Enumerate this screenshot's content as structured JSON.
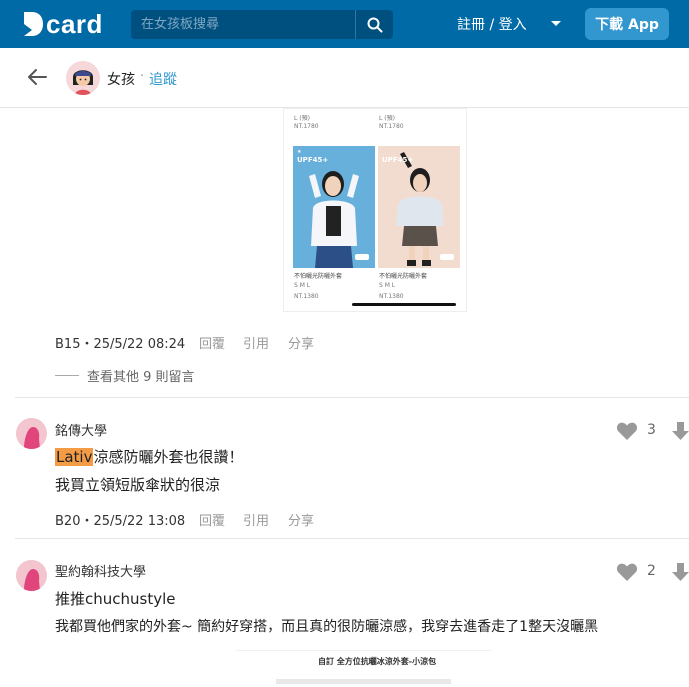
{
  "header": {
    "logo_text": "card",
    "search_placeholder": "在女孩板搜尋",
    "login_label": "註冊 / 登入",
    "download_label": "下載 App",
    "brand_color": "#006aa6"
  },
  "forum": {
    "name": "女孩",
    "separator": "·",
    "follow_label": "追蹤"
  },
  "reply_image": {
    "size_top_left": "L (預)",
    "size_top_right": "L (預)",
    "price_top_left": "NT.1780",
    "price_top_right": "NT.1780",
    "badge_left": "UPF45+",
    "badge_right": "UPF45+",
    "caption_left": "不怕曬光防曬外套",
    "caption_right": "不怕曬光防曬外套",
    "sizes_left": "S   M   L",
    "sizes_right": "S   M   L",
    "price_left": "NT.1380",
    "price_right": "NT.1380"
  },
  "reply_b15": {
    "floor_time": "B15・25/5/22 08:24",
    "reply_label": "回覆",
    "quote_label": "引用",
    "share_label": "分享"
  },
  "view_more": "查看其他 9 則留言",
  "comments": [
    {
      "school": "銘傳大學",
      "highlight": "Lativ",
      "line1_rest": "涼感防曬外套也很讚！",
      "line2": "我買立領短版傘狀的很涼",
      "floor_time": "B20・25/5/22 13:08",
      "reply_label": "回覆",
      "quote_label": "引用",
      "share_label": "分享",
      "likes": "3"
    },
    {
      "school": "聖約翰科技大學",
      "line1": "推推chuchustyle",
      "line2": "我都買他們家的外套~ 簡約好穿搭，而且真的很防曬涼感，我穿去進香走了1整天沒曬黑",
      "likes": "2",
      "image_caption": "自訂 全方位抗曬冰涼外套-小涼包"
    }
  ]
}
